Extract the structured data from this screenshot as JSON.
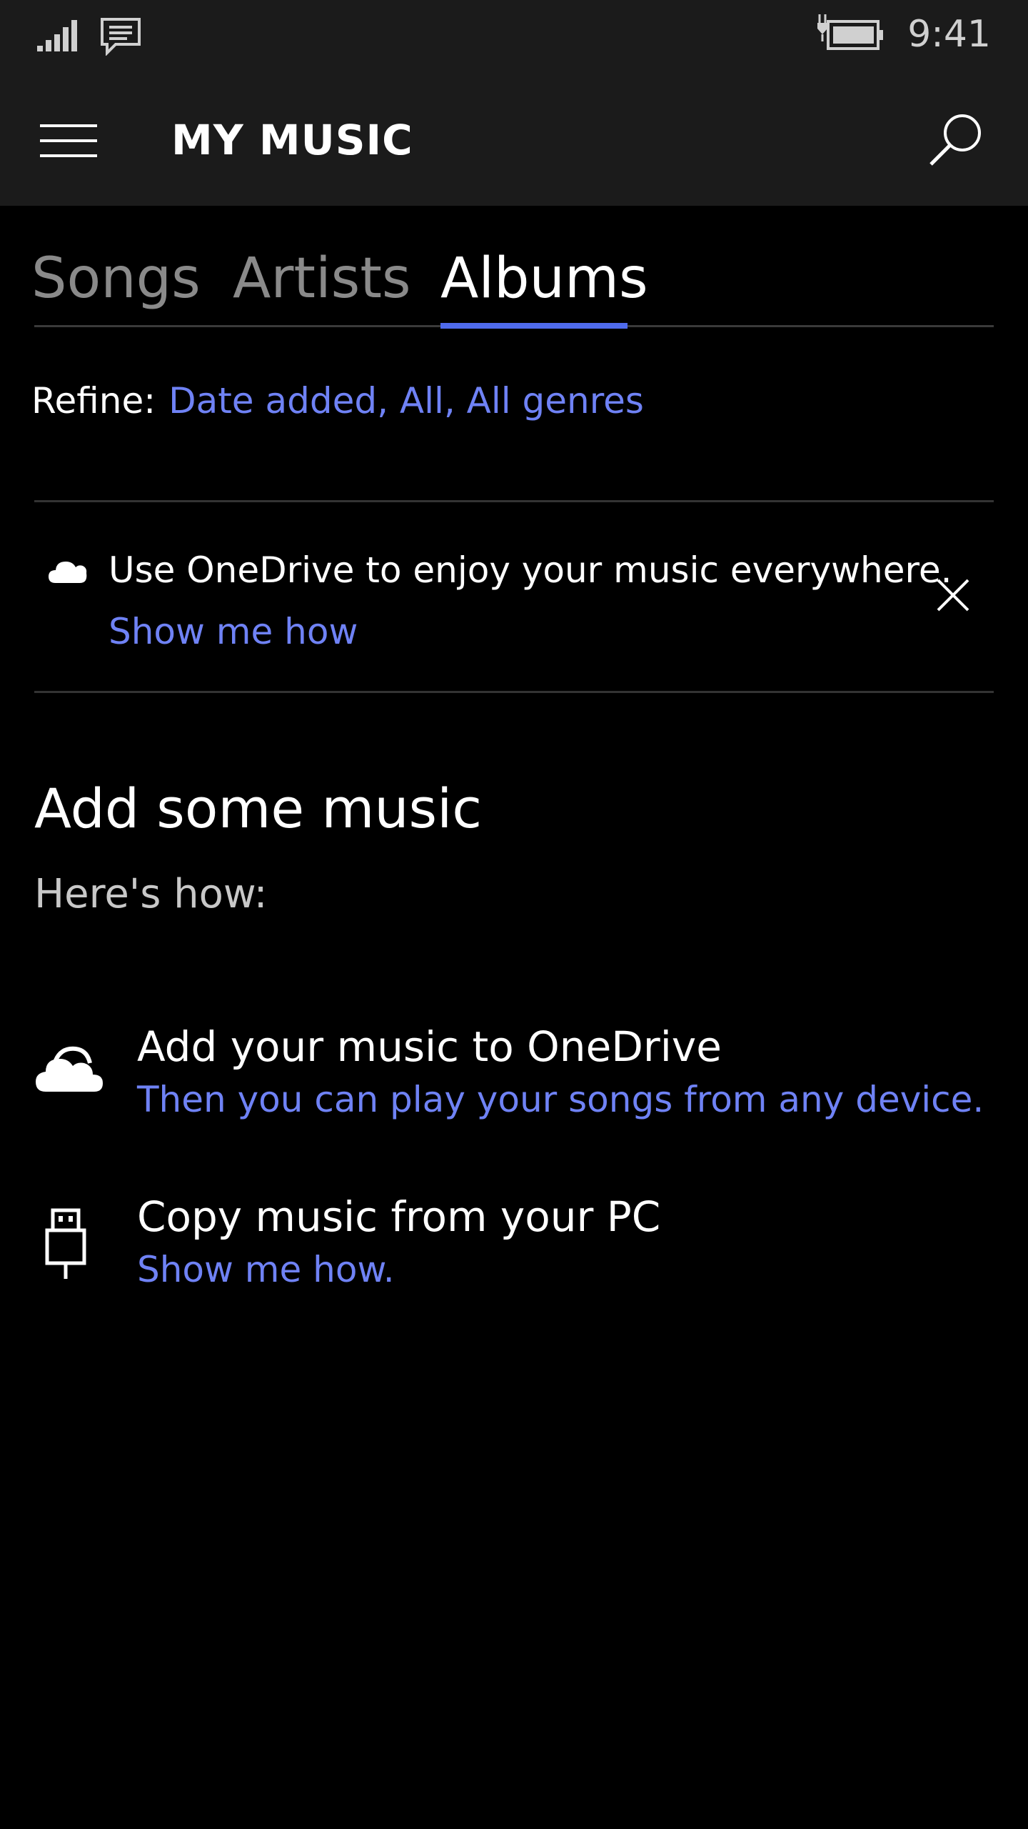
{
  "status_bar": {
    "time": "9:41",
    "icons": [
      "signal-icon",
      "message-icon",
      "battery-charging-icon"
    ]
  },
  "app_bar": {
    "title": "MY MUSIC",
    "icons": [
      "hamburger-menu-icon",
      "search-icon"
    ]
  },
  "tabs": [
    {
      "label": "Songs",
      "active": false
    },
    {
      "label": "Artists",
      "active": false
    },
    {
      "label": "Albums",
      "active": true
    }
  ],
  "refine": {
    "label": "Refine:",
    "value": "Date added, All, All genres"
  },
  "banner": {
    "icon": "cloud-icon",
    "text": "Use OneDrive to enjoy your music everywhere.",
    "link": "Show me how",
    "close_icon": "close-icon"
  },
  "add_music": {
    "title": "Add some music",
    "subtitle": "Here's how:",
    "items": [
      {
        "icon": "onedrive-cloud-icon",
        "title": "Add your music to OneDrive",
        "subtitle": "Then you can play your songs from any device."
      },
      {
        "icon": "usb-icon",
        "title": "Copy music from your PC",
        "subtitle": "Show me how."
      }
    ]
  },
  "colors": {
    "accent": "#4f6bed",
    "link": "#6f82f5",
    "topbar": "#1b1b1b",
    "background": "#000000"
  }
}
